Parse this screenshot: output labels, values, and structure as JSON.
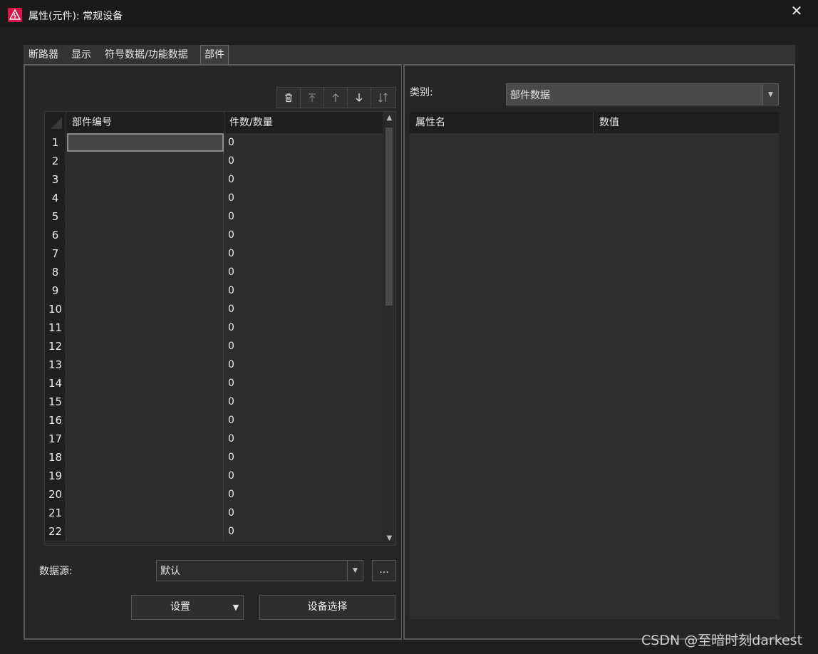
{
  "window": {
    "title": "属性(元件): 常规设备",
    "close_label": "✕"
  },
  "tabs": [
    {
      "label": "断路器",
      "active": false
    },
    {
      "label": "显示",
      "active": false
    },
    {
      "label": "符号数据/功能数据",
      "active": false
    },
    {
      "label": "部件",
      "active": true
    }
  ],
  "toolbar": {
    "delete_icon": "trash-icon",
    "move_top_icon": "move-top-icon",
    "move_up_icon": "arrow-up-icon",
    "move_down_icon": "arrow-down-icon",
    "sort_icon": "swap-vertical-icon"
  },
  "grid": {
    "columns": [
      "部件编号",
      "件数/数量"
    ],
    "rows": [
      {
        "num": "1",
        "part": "",
        "qty": "0"
      },
      {
        "num": "2",
        "part": "",
        "qty": "0"
      },
      {
        "num": "3",
        "part": "",
        "qty": "0"
      },
      {
        "num": "4",
        "part": "",
        "qty": "0"
      },
      {
        "num": "5",
        "part": "",
        "qty": "0"
      },
      {
        "num": "6",
        "part": "",
        "qty": "0"
      },
      {
        "num": "7",
        "part": "",
        "qty": "0"
      },
      {
        "num": "8",
        "part": "",
        "qty": "0"
      },
      {
        "num": "9",
        "part": "",
        "qty": "0"
      },
      {
        "num": "10",
        "part": "",
        "qty": "0"
      },
      {
        "num": "11",
        "part": "",
        "qty": "0"
      },
      {
        "num": "12",
        "part": "",
        "qty": "0"
      },
      {
        "num": "13",
        "part": "",
        "qty": "0"
      },
      {
        "num": "14",
        "part": "",
        "qty": "0"
      },
      {
        "num": "15",
        "part": "",
        "qty": "0"
      },
      {
        "num": "16",
        "part": "",
        "qty": "0"
      },
      {
        "num": "17",
        "part": "",
        "qty": "0"
      },
      {
        "num": "18",
        "part": "",
        "qty": "0"
      },
      {
        "num": "19",
        "part": "",
        "qty": "0"
      },
      {
        "num": "20",
        "part": "",
        "qty": "0"
      },
      {
        "num": "21",
        "part": "",
        "qty": "0"
      },
      {
        "num": "22",
        "part": "",
        "qty": "0"
      }
    ]
  },
  "datasource": {
    "label": "数据源:",
    "value": "默认",
    "more_label": "..."
  },
  "buttons": {
    "settings": "设置",
    "device_select": "设备选择"
  },
  "category": {
    "label": "类别:",
    "value": "部件数据"
  },
  "properties": {
    "columns": [
      "属性名",
      "数值"
    ]
  },
  "watermark": "CSDN @至暗时刻darkest",
  "colors": {
    "accent": "#d9144a",
    "background": "#1f1f1f",
    "panel": "#262626"
  }
}
